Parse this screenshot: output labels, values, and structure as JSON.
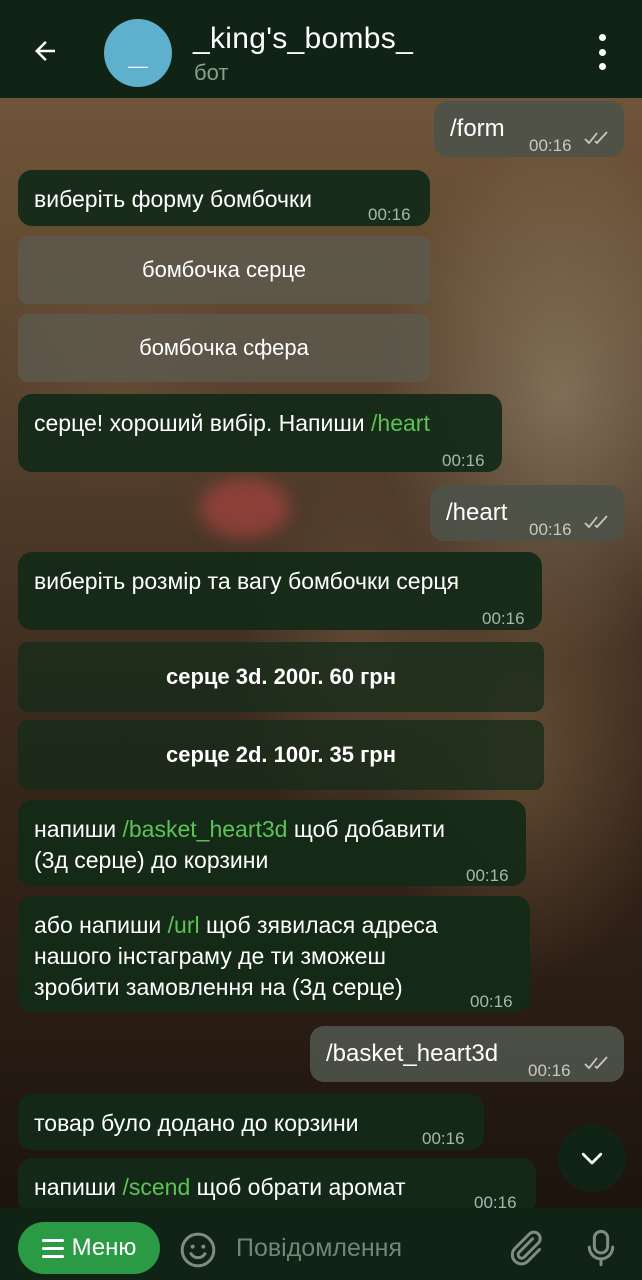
{
  "header": {
    "title": "_king's_bombs_",
    "subtitle": "бот",
    "avatar_letter": "_"
  },
  "messages": [
    {
      "id": "m1",
      "text": "/form",
      "time": "00:16",
      "direction": "out"
    },
    {
      "id": "m2",
      "text": "виберіть форму бомбочки",
      "time": "00:16",
      "direction": "in"
    },
    {
      "id": "m3",
      "text_before": "серце! хороший вибір. Напиши ",
      "cmd": "/heart",
      "time": "00:16",
      "direction": "in"
    },
    {
      "id": "m4",
      "text": "/heart",
      "time": "00:16",
      "direction": "out"
    },
    {
      "id": "m5",
      "text": "виберіть розмір та вагу бомбочки серця",
      "time": "00:16",
      "direction": "in"
    },
    {
      "id": "m6",
      "line1_before": "напиши ",
      "cmd": "/basket_heart3d",
      "line1_after": " щоб добавити",
      "line2": "(3д серце) до корзини",
      "time": "00:16",
      "direction": "in"
    },
    {
      "id": "m7",
      "line1_before": "або напиши ",
      "cmd": "/url",
      "line1_after": " щоб зявилася адреса",
      "line2": "нашого інстаграму де ти зможеш",
      "line3": "зробити замовлення на (3д серце)",
      "time": "00:16",
      "direction": "in"
    },
    {
      "id": "m8",
      "text": "/basket_heart3d",
      "time": "00:16",
      "direction": "out"
    },
    {
      "id": "m9",
      "text": "товар було додано до корзини",
      "time": "00:16",
      "direction": "in"
    },
    {
      "id": "m10",
      "text_before": "напиши ",
      "cmd": "/scend",
      "text_after": " щоб обрати аромат",
      "time": "00:16",
      "direction": "in"
    }
  ],
  "keyboard_form": [
    "бомбочка серце",
    "бомбочка сфера"
  ],
  "keyboard_size": [
    "серце 3d. 200г. 60 грн",
    "серце 2d. 100г. 35 грн"
  ],
  "bottom": {
    "menu_label": "Меню",
    "placeholder": "Повідомлення"
  },
  "colors": {
    "header_bg": "#102314",
    "incoming_bubble": "#132a18",
    "outgoing_bubble": "#4e5248",
    "command_link": "#5dc258",
    "menu_button": "#2b9a45",
    "avatar": "#5fb0cc"
  },
  "icons": {
    "back": "arrow-left-icon",
    "more": "more-vertical-icon",
    "scroll": "chevron-down-icon",
    "menu": "menu-lines-icon",
    "emoji": "smiley-icon",
    "attach": "paperclip-icon",
    "mic": "microphone-icon",
    "read": "double-check-icon"
  }
}
